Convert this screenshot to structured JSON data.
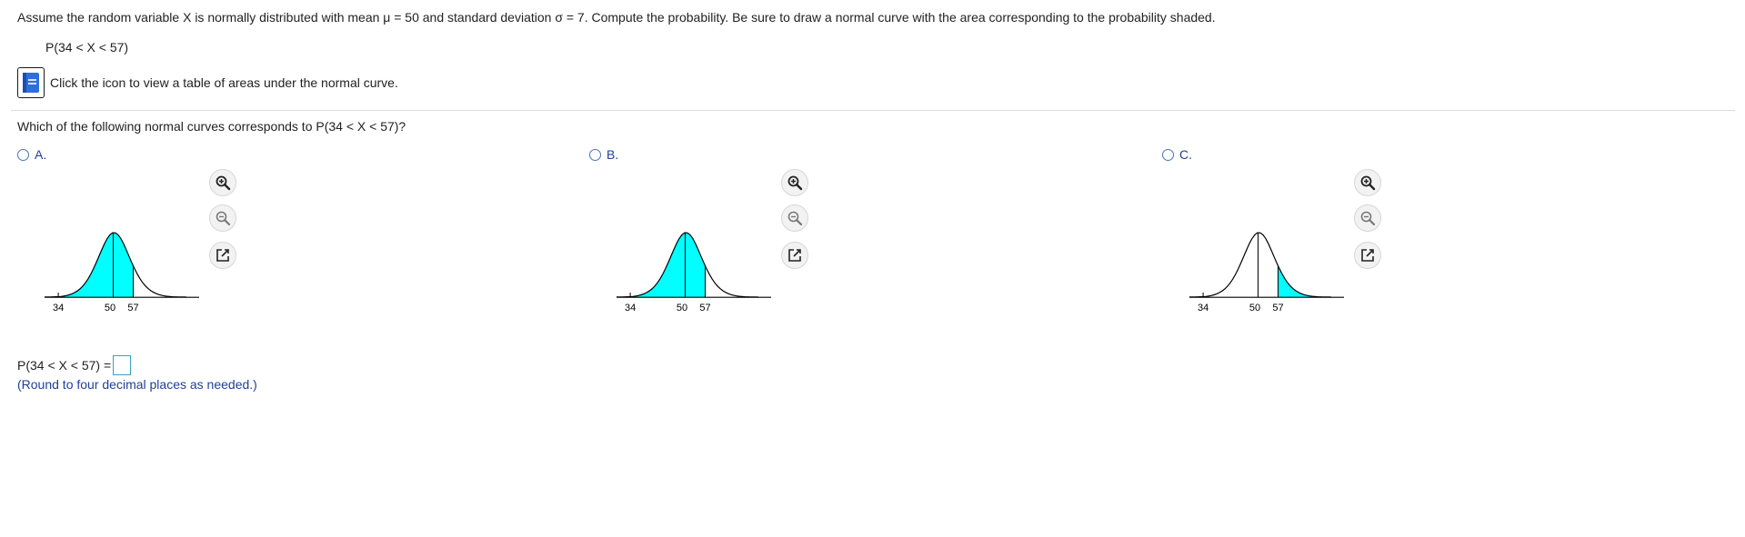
{
  "question": {
    "text": "Assume the random variable X is normally distributed with mean μ = 50 and standard deviation σ = 7. Compute the probability. Be sure to draw a normal curve with the area corresponding to the probability shaded.",
    "probability_expression": "P(34 < X < 57)"
  },
  "info": {
    "text": "Click the icon to view a table of areas under the normal curve.",
    "icon": "table-book-icon"
  },
  "subquestion": {
    "text": "Which of the following normal curves corresponds to P(34 < X < 57)?"
  },
  "options": [
    {
      "label": "A.",
      "ticks": [
        "34",
        "50",
        "57"
      ],
      "shaded": "34 to 57"
    },
    {
      "label": "B.",
      "ticks": [
        "34",
        "50",
        "57"
      ],
      "shaded": "below 57"
    },
    {
      "label": "C.",
      "ticks": [
        "34",
        "50",
        "57"
      ],
      "shaded": "below 34 and above 57"
    }
  ],
  "tools": [
    "zoom-in-icon",
    "zoom-out-icon",
    "open-new-window-icon"
  ],
  "answer": {
    "label": "P(34 < X < 57) =",
    "value": "",
    "hint": "(Round to four decimal places as needed.)"
  },
  "colors": {
    "shade": "#00ffff",
    "link": "#1f3f9a",
    "input_border": "#3aa0c8"
  }
}
